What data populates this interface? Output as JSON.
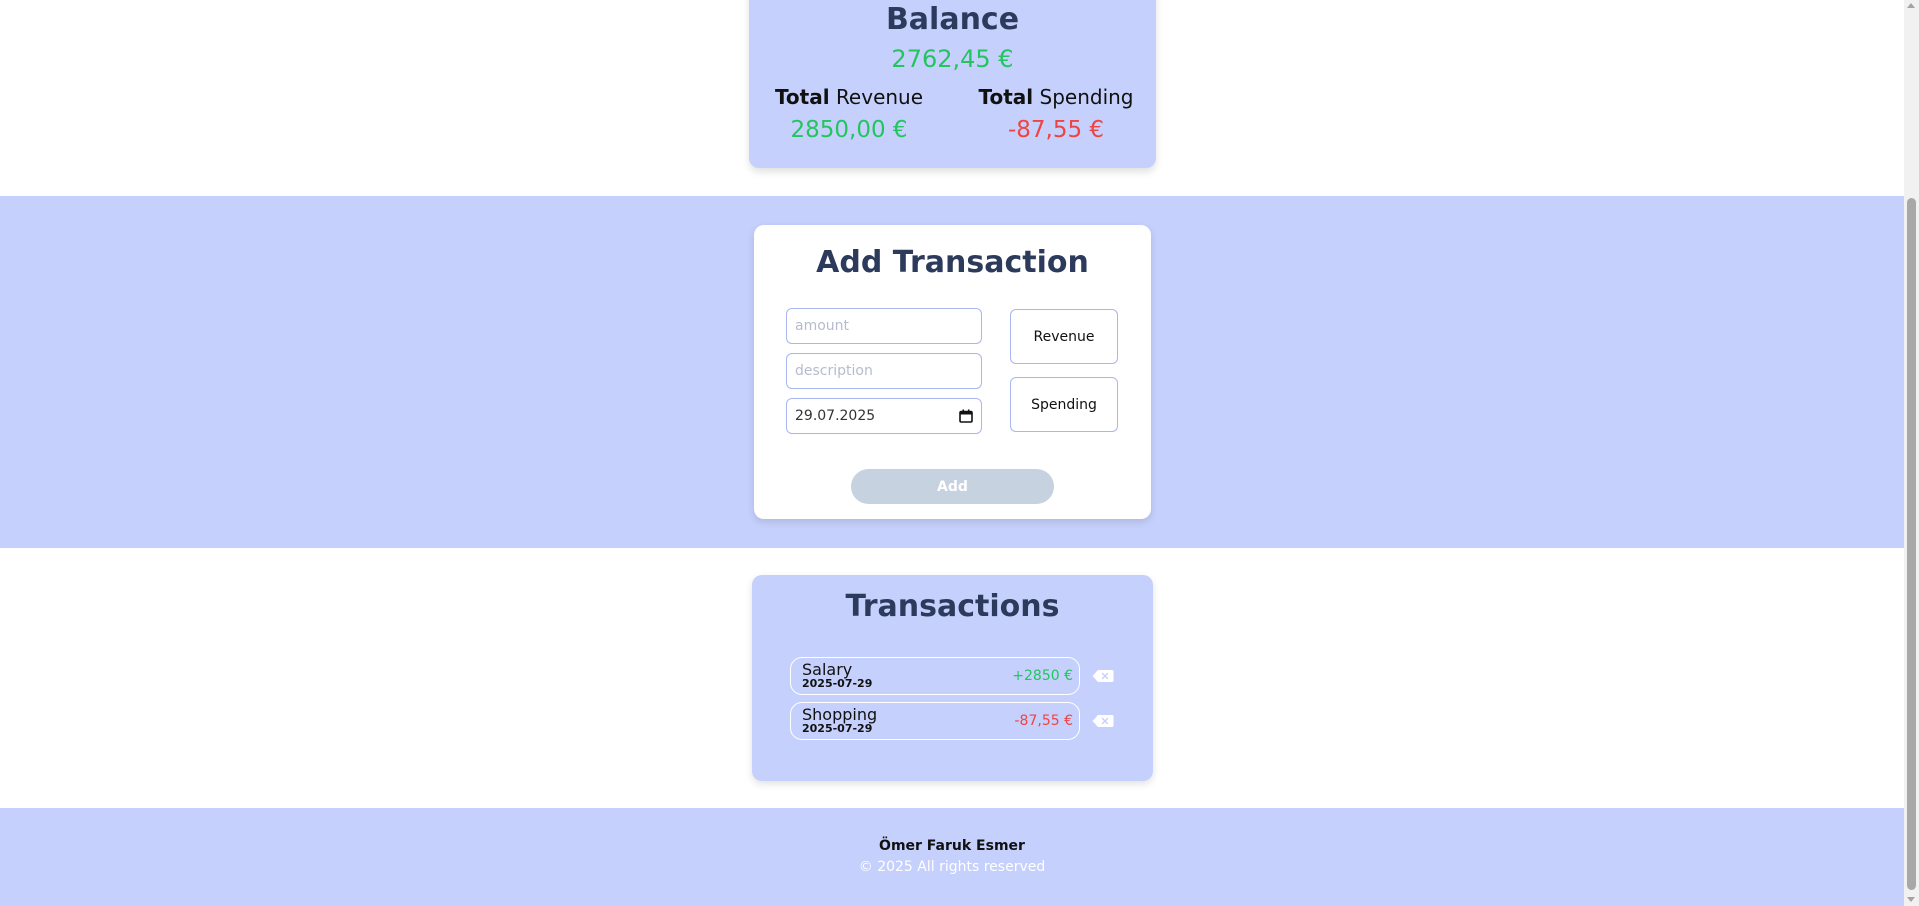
{
  "balance": {
    "title": "Balance",
    "value": "2762,45 €",
    "total_bold": "Total",
    "revenue_label": "Revenue",
    "revenue_value": "2850,00 €",
    "spending_label": "Spending",
    "spending_value": "-87,55 €"
  },
  "add_transaction": {
    "title": "Add Transaction",
    "amount_placeholder": "amount",
    "description_placeholder": "description",
    "date_value": "29.07.2025",
    "revenue_button": "Revenue",
    "spending_button": "Spending",
    "add_button": "Add"
  },
  "transactions": {
    "title": "Transactions",
    "items": [
      {
        "description": "Salary",
        "date": "2025-07-29",
        "amount": "+2850 €",
        "type": "revenue"
      },
      {
        "description": "Shopping",
        "date": "2025-07-29",
        "amount": "-87,55 €",
        "type": "spending"
      }
    ]
  },
  "footer": {
    "author": "Ömer Faruk Esmer",
    "copyright": "© 2025 All rights reserved"
  },
  "colors": {
    "accent_bg": "#c5d0fc",
    "positive": "#22c55e",
    "negative": "#ef4444",
    "title": "#2c3a5c",
    "disabled_button": "#c7d2e0"
  },
  "icons": {
    "calendar": "calendar-icon",
    "delete": "backspace-delete-icon"
  }
}
